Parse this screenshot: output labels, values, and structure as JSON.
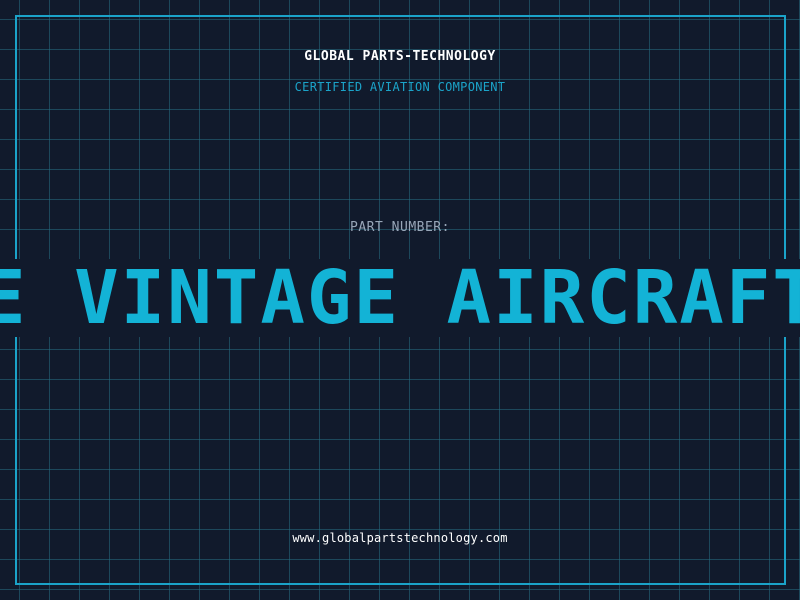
{
  "header": {
    "brand": "GLOBAL PARTS-TECHNOLOGY",
    "subtitle": "CERTIFIED AVIATION COMPONENT"
  },
  "part": {
    "label": "PART NUMBER:",
    "value": "E VINTAGE AIRCRAFT"
  },
  "footer": {
    "url": "www.globalpartstechnology.com"
  },
  "colors": {
    "background": "#111a2c",
    "accent": "#13b3d6",
    "grid": "#266e82",
    "label": "#98a6b8",
    "text": "#ffffff"
  }
}
